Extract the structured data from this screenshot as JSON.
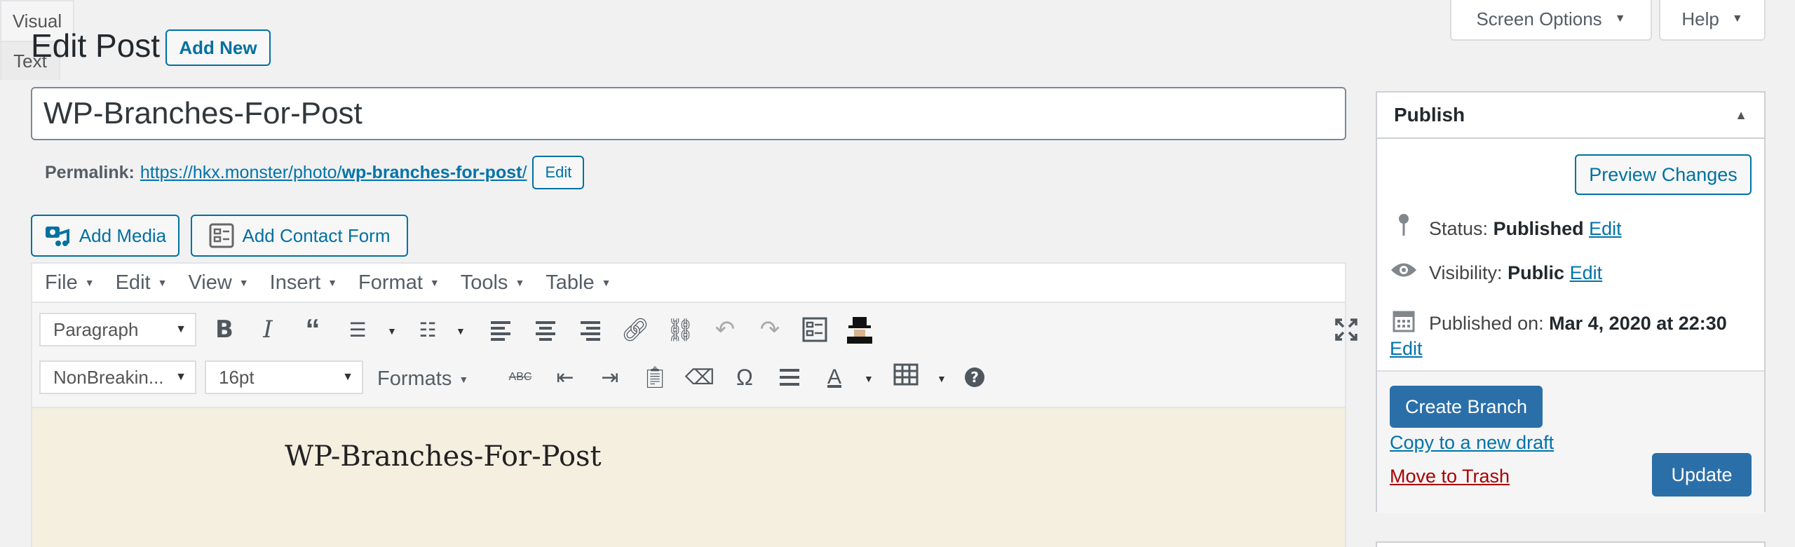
{
  "header": {
    "screen_options": "Screen Options",
    "help": "Help",
    "page_title": "Edit Post",
    "add_new": "Add New"
  },
  "post": {
    "title": "WP-Branches-For-Post",
    "permalink_label": "Permalink:",
    "permalink_base": "https://hkx.monster/photo/",
    "permalink_slug": "wp-branches-for-post",
    "permalink_trail": "/",
    "permalink_edit": "Edit"
  },
  "media": {
    "add_media": "Add Media",
    "add_contact_form": "Add Contact Form"
  },
  "editor": {
    "tabs": [
      "Visual",
      "Text"
    ],
    "menu": [
      "File",
      "Edit",
      "View",
      "Insert",
      "Format",
      "Tools",
      "Table"
    ],
    "paragraph_select": "Paragraph",
    "font_select": "NonBreakin...",
    "size_select": "16pt",
    "formats": "Formats",
    "content_title": "WP-Branches-For-Post"
  },
  "publish": {
    "title": "Publish",
    "preview": "Preview Changes",
    "status_label": "Status:",
    "status_value": "Published",
    "visibility_label": "Visibility:",
    "visibility_value": "Public",
    "published_label": "Published on:",
    "published_value": "Mar 4, 2020 at 22:30",
    "edit": "Edit",
    "create_branch": "Create Branch",
    "copy_draft": "Copy to a new draft",
    "trash": "Move to Trash",
    "update": "Update"
  },
  "colors": {
    "accent": "#0073aa",
    "primary_button": "#2b6fa9",
    "trash": "#a00",
    "editor_bg": "#f5efe0"
  }
}
